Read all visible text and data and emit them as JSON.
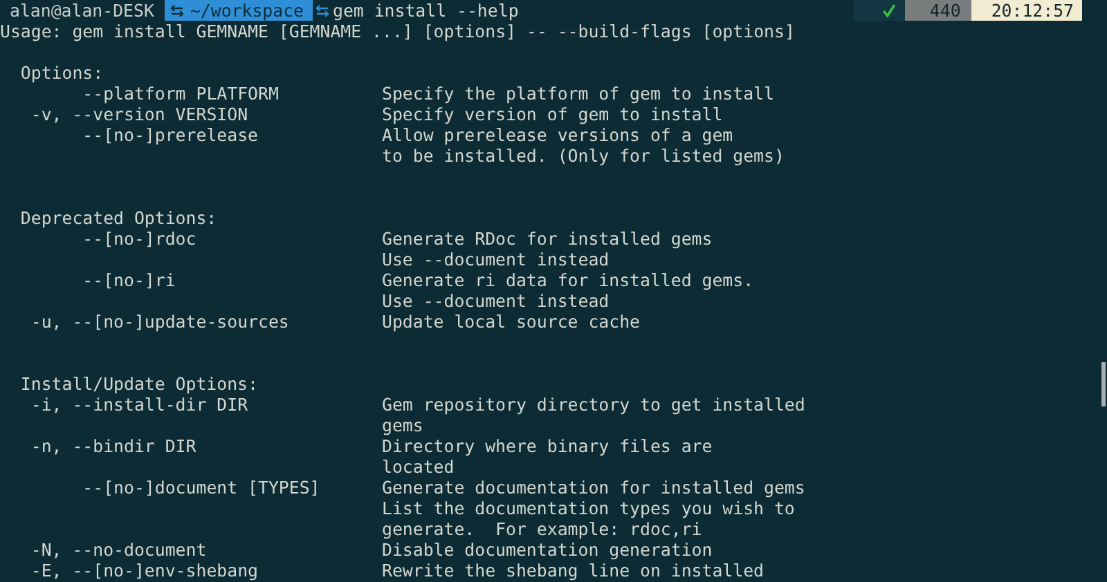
{
  "prompt": {
    "user": "alan@alan-DESK",
    "directory": "~/workspace",
    "command": "gem install --help"
  },
  "status": {
    "exit_ok": true,
    "number": "440",
    "time": "20:12:57"
  },
  "lines": [
    {
      "kind": "text",
      "text": "Usage: gem install GEMNAME [GEMNAME ...] [options] -- --build-flags [options]"
    },
    {
      "kind": "blank"
    },
    {
      "kind": "heading",
      "text": "Options:"
    },
    {
      "kind": "long_option",
      "flag": "--platform PLATFORM",
      "description": "Specify the platform of gem to install"
    },
    {
      "kind": "short_option",
      "flag": "-v, --version VERSION",
      "description": "Specify version of gem to install"
    },
    {
      "kind": "long_option",
      "flag": "--[no-]prerelease",
      "description": "Allow prerelease versions of a gem"
    },
    {
      "kind": "continuation",
      "description": "to be installed. (Only for listed gems)"
    },
    {
      "kind": "blank"
    },
    {
      "kind": "blank"
    },
    {
      "kind": "heading",
      "text": "Deprecated Options:"
    },
    {
      "kind": "long_option",
      "flag": "--[no-]rdoc",
      "description": "Generate RDoc for installed gems"
    },
    {
      "kind": "continuation",
      "description": "Use --document instead"
    },
    {
      "kind": "long_option",
      "flag": "--[no-]ri",
      "description": "Generate ri data for installed gems."
    },
    {
      "kind": "continuation",
      "description": "Use --document instead"
    },
    {
      "kind": "short_option",
      "flag": "-u, --[no-]update-sources",
      "description": "Update local source cache"
    },
    {
      "kind": "blank"
    },
    {
      "kind": "blank"
    },
    {
      "kind": "heading",
      "text": "Install/Update Options:"
    },
    {
      "kind": "short_option",
      "flag": "-i, --install-dir DIR",
      "description": "Gem repository directory to get installed"
    },
    {
      "kind": "continuation",
      "description": "gems"
    },
    {
      "kind": "short_option",
      "flag": "-n, --bindir DIR",
      "description": "Directory where binary files are"
    },
    {
      "kind": "continuation",
      "description": "located"
    },
    {
      "kind": "long_option",
      "flag": "--[no-]document [TYPES]",
      "description": "Generate documentation for installed gems"
    },
    {
      "kind": "continuation",
      "description": "List the documentation types you wish to"
    },
    {
      "kind": "continuation",
      "description": "generate.  For example: rdoc,ri"
    },
    {
      "kind": "short_option",
      "flag": "-N, --no-document",
      "description": "Disable documentation generation"
    },
    {
      "kind": "short_option",
      "flag": "-E, --[no-]env-shebang",
      "description": "Rewrite the shebang line on installed"
    }
  ]
}
